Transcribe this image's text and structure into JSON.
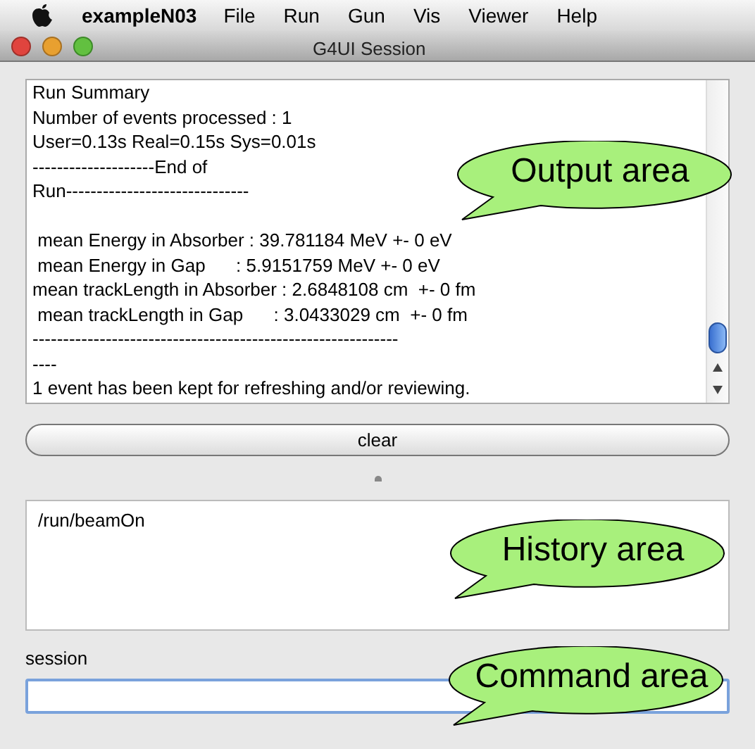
{
  "menu_bar": {
    "app_name": "exampleN03",
    "items": [
      "File",
      "Run",
      "Gun",
      "Vis",
      "Viewer",
      "Help"
    ]
  },
  "window": {
    "title": "G4UI Session"
  },
  "output": {
    "lines": [
      {
        "kind": "text",
        "text": "Run Summary"
      },
      {
        "kind": "text",
        "text": "Number of events processed : 1"
      },
      {
        "kind": "text",
        "text": "User=0.13s Real=0.15s Sys=0.01s"
      },
      {
        "kind": "text",
        "text": "--------------------End of"
      },
      {
        "kind": "text",
        "text": "Run------------------------------"
      },
      {
        "kind": "blank"
      },
      {
        "kind": "text",
        "text": " mean Energy in Absorber : 39.781184 MeV +- 0 eV"
      },
      {
        "kind": "text",
        "text": " mean Energy in Gap      : 5.9151759 MeV +- 0 eV"
      },
      {
        "kind": "text",
        "text": "mean trackLength in Absorber : 2.6848108 cm  +- 0 fm"
      },
      {
        "kind": "text",
        "text": " mean trackLength in Gap      : 3.0433029 cm  +- 0 fm"
      },
      {
        "kind": "text",
        "text": "------------------------------------------------------------"
      },
      {
        "kind": "text",
        "text": "----"
      },
      {
        "kind": "text",
        "text": "1 event has been kept for refreshing and/or reviewing."
      }
    ]
  },
  "clear_button": {
    "label": "clear"
  },
  "history": {
    "items": [
      "/run/beamOn"
    ]
  },
  "session": {
    "label": "session"
  },
  "callouts": [
    {
      "text": "Output area"
    },
    {
      "text": "History area"
    },
    {
      "text": "Command area"
    }
  ]
}
